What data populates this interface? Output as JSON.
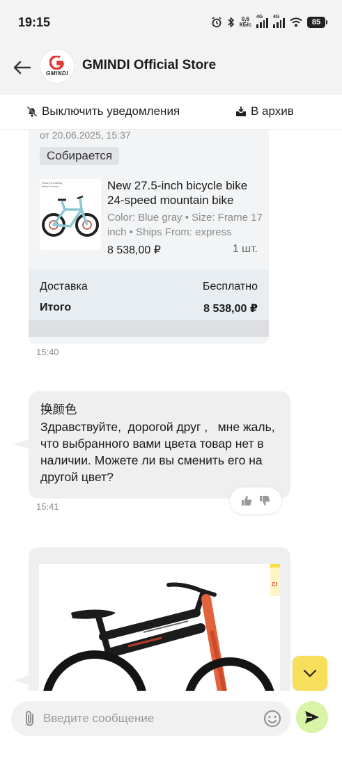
{
  "status_bar": {
    "time": "19:15",
    "net_speed_value": "0,6",
    "net_speed_unit": "КБ/с",
    "signal1_label": "4G",
    "signal2_label": "4G",
    "battery": "85",
    "icons": [
      "alarm-icon",
      "bluetooth-icon",
      "signal-icon",
      "signal-icon",
      "wifi-icon",
      "battery-icon"
    ]
  },
  "header": {
    "back_icon": "arrow-left-icon",
    "store_logo_text": "GMINDI",
    "store_name": "GMINDI Official Store"
  },
  "actions": {
    "mute_label": "Выключить уведомления",
    "archive_label": "В архив"
  },
  "order_card": {
    "date": "от 20.06.2025, 15:37",
    "status": "Собирается",
    "product": {
      "thumb_caption_line1": "Heavy & Lasting",
      "thumb_caption_line2": "Made Forever",
      "title": "New 27.5-inch bicycle bike 24-speed mountain bike",
      "props": "Color: Blue gray • Size: Frame 17 inch • Ships From: express",
      "price": "8 538,00 ₽",
      "qty": "1 шт."
    },
    "delivery_label": "Доставка",
    "delivery_value": "Бесплатно",
    "total_label": "Итого",
    "total_value": "8 538,00 ₽",
    "time": "15:40"
  },
  "message": {
    "original": "换颜色",
    "text": "Здравствуйте,  дорогой друг ,   мне жаль, что выбранного вами цвета товар нет в наличии. Можете ли вы сменить его на другой цвет?",
    "time": "15:41"
  },
  "image_message": {
    "tag_text": "CI"
  },
  "composer": {
    "placeholder": "Введите сообщение"
  },
  "colors": {
    "accent_yellow": "#f7de5b",
    "send_green": "#d8f4a6",
    "logo_red": "#e23a2e",
    "bubble_gray": "#efefef"
  }
}
